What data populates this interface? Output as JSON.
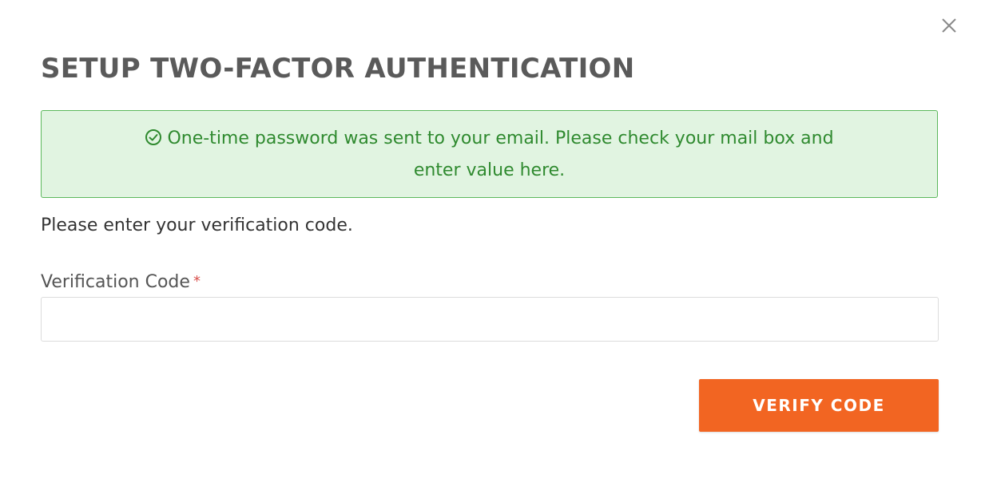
{
  "modal": {
    "title": "SETUP TWO-FACTOR AUTHENTICATION",
    "close_icon": "close-icon"
  },
  "alert": {
    "icon": "check-circle-icon",
    "message": "One-time password was sent to your email. Please check your mail box and enter value here.",
    "color": "#2f8a2f",
    "background": "#e1f4e1",
    "border_color": "#5cb85c"
  },
  "form": {
    "instruction": "Please enter your verification code.",
    "field_label": "Verification Code",
    "required_marker": "*",
    "code_value": "",
    "code_placeholder": ""
  },
  "actions": {
    "verify_label": "VERIFY CODE",
    "verify_color": "#f26522"
  }
}
